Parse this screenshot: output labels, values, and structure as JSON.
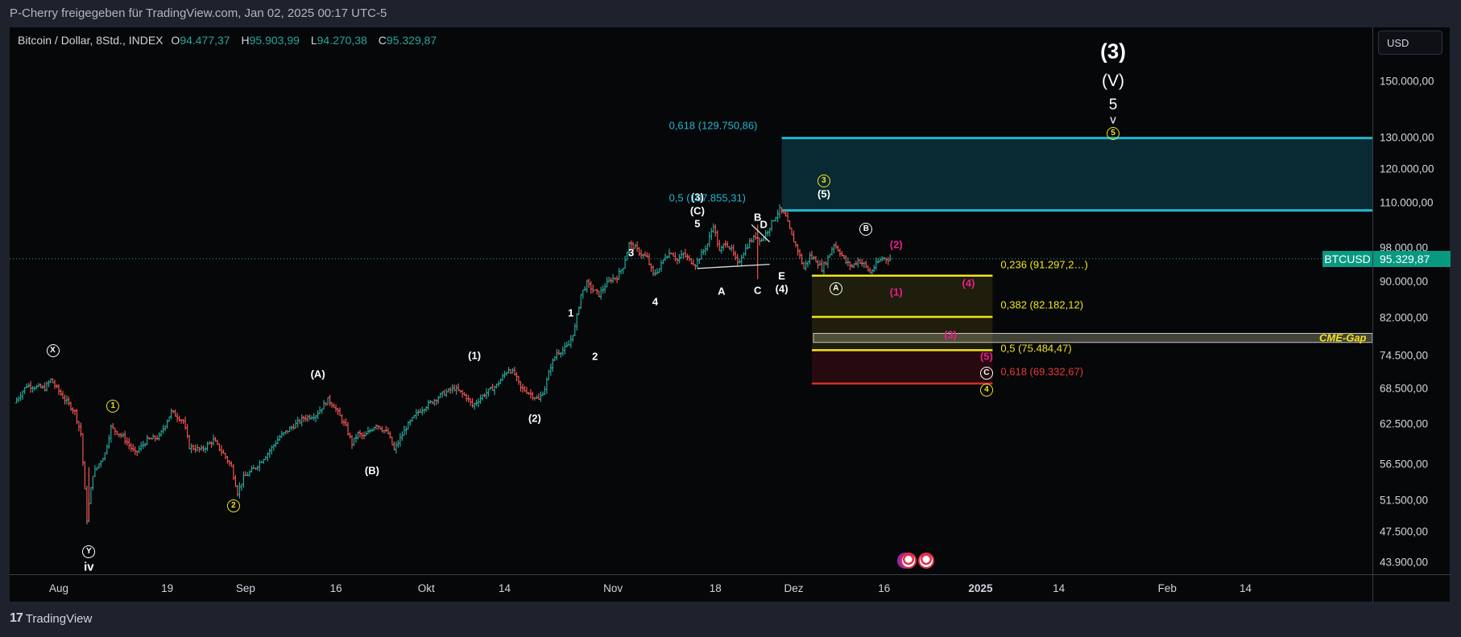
{
  "share_text": "P-Cherry freigegeben für TradingView.com, Jan 02, 2025 00:17 UTC-5",
  "legend": {
    "symbol": "Bitcoin / Dollar, 8Std., INDEX",
    "o_label": "O",
    "o_value": "94.477,37",
    "h_label": "H",
    "h_value": "95.903,99",
    "l_label": "L",
    "l_value": "94.270,38",
    "c_label": "C",
    "c_value": "95.329,87"
  },
  "currency_button": "USD",
  "current_price": {
    "symbol": "BTCUSD",
    "value": "95.329,87",
    "price": 95329.87
  },
  "footer_brand": "TradingView",
  "footer_logo": "17",
  "colors": {
    "up": "#26a69a",
    "down": "#ef5350",
    "fib_cyan": "#22b5d0",
    "fib_yellow": "#f2e41c",
    "fib_red": "#d32f2f",
    "wave_pink": "#e91e8c",
    "price_tag": "#089981"
  },
  "chart_data": {
    "type": "ohlc",
    "title": "Bitcoin / Dollar, 8Std., INDEX",
    "scale": "log",
    "ylim": [
      42500,
      170000
    ],
    "price_ticks": [
      {
        "value": 150000,
        "label": "150.000,00"
      },
      {
        "value": 130000,
        "label": "130.000,00"
      },
      {
        "value": 120000,
        "label": "120.000,00"
      },
      {
        "value": 110000,
        "label": "110.000,00"
      },
      {
        "value": 98000,
        "label": "98.000,00"
      },
      {
        "value": 90000,
        "label": "90.000,00"
      },
      {
        "value": 82000,
        "label": "82.000,00"
      },
      {
        "value": 74500,
        "label": "74.500,00"
      },
      {
        "value": 68500,
        "label": "68.500,00"
      },
      {
        "value": 62500,
        "label": "62.500,00"
      },
      {
        "value": 56500,
        "label": "56.500,00"
      },
      {
        "value": 51500,
        "label": "51.500,00"
      },
      {
        "value": 47500,
        "label": "47.500,00"
      },
      {
        "value": 43900,
        "label": "43.900,00"
      }
    ],
    "time_ticks": [
      {
        "day": 0,
        "label": "Aug"
      },
      {
        "day": 18,
        "label": "19"
      },
      {
        "day": 31,
        "label": "Sep"
      },
      {
        "day": 46,
        "label": "16"
      },
      {
        "day": 61,
        "label": "Okt"
      },
      {
        "day": 74,
        "label": "14"
      },
      {
        "day": 92,
        "label": "Nov"
      },
      {
        "day": 109,
        "label": "18"
      },
      {
        "day": 122,
        "label": "Dez"
      },
      {
        "day": 137,
        "label": "16"
      },
      {
        "day": 153,
        "label": "2025",
        "bold": true
      },
      {
        "day": 166,
        "label": "14"
      },
      {
        "day": 184,
        "label": "Feb"
      },
      {
        "day": 197,
        "label": "14"
      }
    ],
    "price_path": [
      [
        -7,
        66000
      ],
      [
        -5,
        69000
      ],
      [
        -2,
        68500
      ],
      [
        -1,
        70000
      ],
      [
        1,
        67000
      ],
      [
        3,
        64500
      ],
      [
        4,
        61000
      ],
      [
        5,
        49000
      ],
      [
        6,
        55000
      ],
      [
        8,
        58000
      ],
      [
        9,
        62000
      ],
      [
        11,
        60500
      ],
      [
        13,
        58000
      ],
      [
        15,
        60000
      ],
      [
        17,
        60500
      ],
      [
        19,
        64500
      ],
      [
        21,
        63000
      ],
      [
        22,
        59000
      ],
      [
        24,
        58500
      ],
      [
        26,
        60000
      ],
      [
        28,
        57500
      ],
      [
        29,
        56000
      ],
      [
        30,
        52500
      ],
      [
        31,
        54500
      ],
      [
        33,
        56000
      ],
      [
        35,
        58000
      ],
      [
        37,
        60500
      ],
      [
        39,
        62000
      ],
      [
        41,
        63500
      ],
      [
        43,
        64000
      ],
      [
        45,
        66500
      ],
      [
        46,
        65500
      ],
      [
        48,
        62000
      ],
      [
        49,
        59500
      ],
      [
        50,
        61000
      ],
      [
        51,
        60500
      ],
      [
        53,
        62500
      ],
      [
        55,
        61000
      ],
      [
        56,
        58500
      ],
      [
        58,
        62000
      ],
      [
        60,
        64500
      ],
      [
        62,
        66000
      ],
      [
        64,
        67500
      ],
      [
        66,
        68500
      ],
      [
        68,
        67000
      ],
      [
        69,
        65500
      ],
      [
        71,
        67500
      ],
      [
        73,
        69000
      ],
      [
        75,
        72000
      ],
      [
        76,
        71000
      ],
      [
        77,
        68500
      ],
      [
        78,
        68000
      ],
      [
        80,
        66500
      ],
      [
        81,
        68500
      ],
      [
        82,
        72500
      ],
      [
        83,
        75000
      ],
      [
        84,
        75500
      ],
      [
        85,
        76500
      ],
      [
        86,
        80000
      ],
      [
        87,
        87000
      ],
      [
        88,
        89500
      ],
      [
        89,
        88000
      ],
      [
        90,
        87000
      ],
      [
        91,
        89000
      ],
      [
        92,
        90500
      ],
      [
        93,
        91000
      ],
      [
        94,
        93500
      ],
      [
        95,
        99000
      ],
      [
        96,
        98000
      ],
      [
        97,
        96500
      ],
      [
        98,
        95500
      ],
      [
        99,
        91500
      ],
      [
        100,
        93000
      ],
      [
        101,
        96000
      ],
      [
        102,
        97000
      ],
      [
        103,
        95000
      ],
      [
        104,
        96500
      ],
      [
        105,
        95000
      ],
      [
        106,
        94000
      ],
      [
        108,
        99000
      ],
      [
        109,
        104000
      ],
      [
        110,
        97000
      ],
      [
        111,
        99500
      ],
      [
        112,
        97500
      ],
      [
        113,
        94000
      ],
      [
        114,
        97000
      ],
      [
        115,
        99500
      ],
      [
        116,
        101000
      ],
      [
        117,
        100000
      ],
      [
        118,
        102500
      ],
      [
        119,
        105500
      ],
      [
        120,
        108000
      ],
      [
        121,
        106000
      ],
      [
        122,
        101000
      ],
      [
        123,
        97500
      ],
      [
        124,
        93000
      ],
      [
        125,
        96000
      ],
      [
        126,
        95000
      ],
      [
        127,
        93000
      ],
      [
        128,
        95500
      ],
      [
        129,
        99000
      ],
      [
        130,
        97000
      ],
      [
        131,
        94500
      ],
      [
        132,
        93500
      ],
      [
        133,
        95000
      ],
      [
        134,
        94000
      ],
      [
        135,
        92000
      ],
      [
        136,
        94000
      ],
      [
        137,
        95500
      ],
      [
        138,
        95329
      ]
    ],
    "current_day": 138,
    "fib_extension": {
      "levels": [
        {
          "ratio": "0,618",
          "price": 129750.86,
          "label": "0,618 (129.750,86)"
        },
        {
          "ratio": "0,5",
          "price": 107855.31,
          "label": "0,5 (107.855,31)"
        }
      ],
      "start_day": 120
    },
    "fib_retracement": {
      "start_day": 125,
      "end_day": 155,
      "levels": [
        {
          "ratio": "0,236",
          "price": 91297.2,
          "label": "0,236 (91.297,2…)",
          "color": "yellow"
        },
        {
          "ratio": "0,382",
          "price": 82182.12,
          "label": "0,382 (82.182,12)",
          "color": "yellow"
        },
        {
          "ratio": "0,5",
          "price": 75484.47,
          "label": "0,5 (75.484,47)",
          "color": "yellow"
        },
        {
          "ratio": "0,618",
          "price": 69332.67,
          "label": "0,618 (69.332,67)",
          "color": "red"
        }
      ]
    },
    "cme_gap": {
      "label": "CME-Gap",
      "high": 78800,
      "low": 77000,
      "start_day": 125
    },
    "triangle": {
      "upper": [
        [
          115,
          104000
        ],
        [
          118,
          99500
        ]
      ],
      "lower": [
        [
          106,
          93000
        ],
        [
          118,
          94000
        ]
      ]
    },
    "wave_labels": [
      {
        "text": "X",
        "style": "circle",
        "day": -1,
        "price": 75500
      },
      {
        "text": "Y",
        "style": "circle",
        "day": 5,
        "price": 45200
      },
      {
        "text": "iv",
        "style": "plain",
        "day": 5,
        "price": 43400
      },
      {
        "text": "1",
        "style": "circle-yellow",
        "day": 9,
        "price": 65600
      },
      {
        "text": "2",
        "style": "circle-yellow",
        "day": 29,
        "price": 50800
      },
      {
        "text": "(A)",
        "style": "plain",
        "day": 43,
        "price": 71000
      },
      {
        "text": "(B)",
        "style": "plain",
        "day": 52,
        "price": 55500
      },
      {
        "text": "(1)",
        "style": "plain",
        "day": 69,
        "price": 74500
      },
      {
        "text": "(2)",
        "style": "plain",
        "day": 79,
        "price": 63500
      },
      {
        "text": "1",
        "style": "plain",
        "day": 85,
        "price": 83000
      },
      {
        "text": "2",
        "style": "plain",
        "day": 89,
        "price": 74300
      },
      {
        "text": "3",
        "style": "plain",
        "day": 95,
        "price": 96800
      },
      {
        "text": "4",
        "style": "plain",
        "day": 99,
        "price": 85500
      },
      {
        "text": "(3)",
        "style": "plain",
        "day": 106,
        "price": 111500
      },
      {
        "text": "(C)",
        "style": "plain",
        "day": 106,
        "price": 107800
      },
      {
        "text": "5",
        "style": "plain",
        "day": 106,
        "price": 104300
      },
      {
        "text": "A",
        "style": "plain",
        "day": 110,
        "price": 87700
      },
      {
        "text": "B",
        "style": "plain",
        "day": 116,
        "price": 106000
      },
      {
        "text": "D",
        "style": "plain",
        "day": 117,
        "price": 104000
      },
      {
        "text": "C",
        "style": "plain",
        "day": 116,
        "price": 88000
      },
      {
        "text": "E",
        "style": "plain",
        "day": 120,
        "price": 91200
      },
      {
        "text": "(4)",
        "style": "plain",
        "day": 120,
        "price": 88300
      },
      {
        "text": "3",
        "style": "circle-yellow",
        "day": 127,
        "price": 116500
      },
      {
        "text": "(5)",
        "style": "plain",
        "day": 127,
        "price": 112500
      },
      {
        "text": "B",
        "style": "circle",
        "day": 134,
        "price": 103000
      },
      {
        "text": "(2)",
        "style": "pink",
        "day": 139,
        "price": 98800
      },
      {
        "text": "A",
        "style": "circle",
        "day": 129,
        "price": 88500
      },
      {
        "text": "(1)",
        "style": "pink",
        "day": 139,
        "price": 87500
      },
      {
        "text": "(4)",
        "style": "pink",
        "day": 151,
        "price": 89500
      },
      {
        "text": "(3)",
        "style": "pink",
        "day": 148,
        "price": 78500
      },
      {
        "text": "(5)",
        "style": "pink",
        "day": 154,
        "price": 74300
      },
      {
        "text": "C",
        "style": "circle",
        "day": 154,
        "price": 71300
      },
      {
        "text": "4",
        "style": "circle-yellow",
        "day": 154,
        "price": 68300
      },
      {
        "text": "(3)",
        "style": "big",
        "day": 175,
        "price": 162000
      },
      {
        "text": "(V)",
        "style": "medium",
        "day": 175,
        "price": 150000
      },
      {
        "text": "5",
        "style": "mid",
        "day": 175,
        "price": 141000
      },
      {
        "text": "v",
        "style": "small",
        "day": 175,
        "price": 136000
      },
      {
        "text": "5",
        "style": "circle-yellow",
        "day": 175,
        "price": 131500
      }
    ],
    "events": [
      {
        "day": 141,
        "type": "us-economic"
      },
      {
        "day": 144,
        "type": "us-economic"
      }
    ]
  }
}
